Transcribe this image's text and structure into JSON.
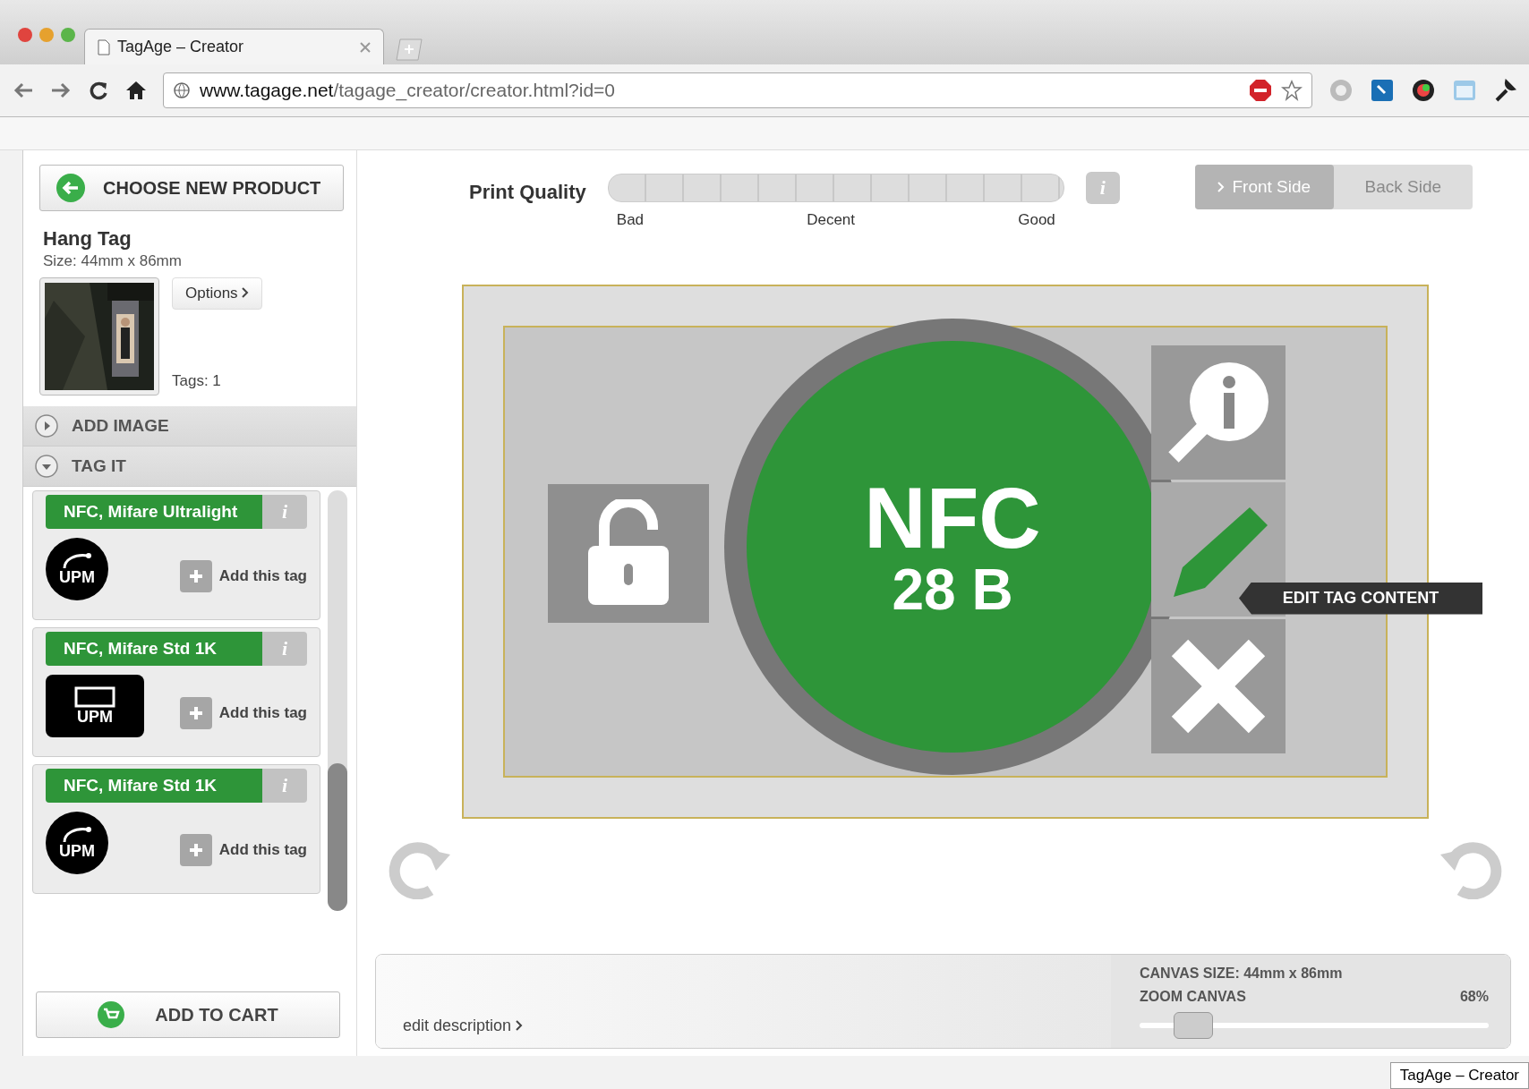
{
  "browser": {
    "tab_title": "TagAge – Creator",
    "url_host": "www.tagage.net",
    "url_path": "/tagage_creator/creator.html?id=0"
  },
  "sidebar": {
    "choose_button": "CHOOSE NEW PRODUCT",
    "product_name": "Hang Tag",
    "product_size": "Size: 44mm x 86mm",
    "options_button": "Options",
    "tags_count": "Tags: 1",
    "sections": [
      {
        "label": "ADD IMAGE",
        "expanded": false
      },
      {
        "label": "TAG IT",
        "expanded": true
      }
    ],
    "tags": [
      {
        "name": "NFC, Mifare Ultralight",
        "kind": "round",
        "info": "i",
        "logo_text": "UPM",
        "add_label": "Add this tag"
      },
      {
        "name": "NFC, Mifare Std 1K",
        "kind": "card",
        "info": "i",
        "logo_text": "UPM",
        "add_label": "Add this tag"
      },
      {
        "name": "NFC, Mifare Std 1K",
        "kind": "round",
        "info": "i",
        "logo_text": "UPM",
        "add_label": "Add this tag"
      }
    ],
    "cart_button": "ADD TO CART"
  },
  "print_quality": {
    "label": "Print Quality",
    "info": "i",
    "scale": [
      "Bad",
      "Decent",
      "Good"
    ]
  },
  "side_toggle": [
    {
      "label": "Front Side",
      "selected": true
    },
    {
      "label": "Back Side",
      "selected": false
    }
  ],
  "canvas": {
    "tag_type": "NFC",
    "tag_size": "28 B",
    "tooltip": "EDIT TAG CONTENT"
  },
  "bottom": {
    "edit_description": "edit description",
    "canvas_size": "CANVAS SIZE: 44mm x 86mm",
    "zoom_label": "ZOOM CANVAS",
    "zoom_reading": "68%",
    "zoom": {
      "level": 0.15
    }
  },
  "status_tooltip": "TagAge – Creator"
}
